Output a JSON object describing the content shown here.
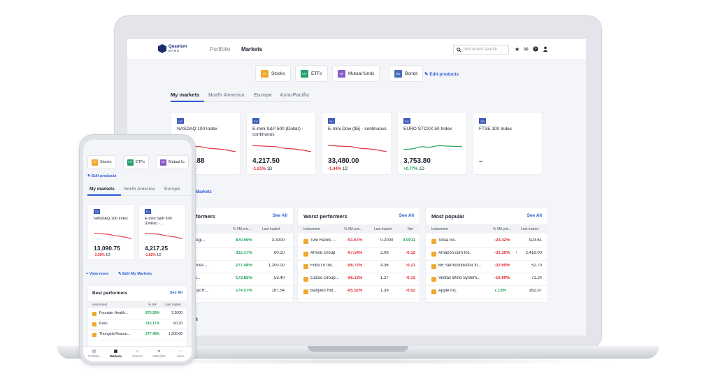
{
  "brand": {
    "name": "Quantum",
    "sub": "BANK"
  },
  "nav": {
    "portfolio": "Portfolio",
    "markets": "Markets"
  },
  "search": {
    "placeholder": "Instrument search"
  },
  "icons": {
    "search": "search-icon",
    "star": "star-icon",
    "mail": "mail-icon",
    "help": "help-icon",
    "user": "user-icon"
  },
  "categories": [
    {
      "label": "Stocks",
      "badge": "ST",
      "color": "#f0a830"
    },
    {
      "label": "ETFs",
      "badge": "ETF",
      "color": "#23a06a"
    },
    {
      "label": "Mutual funds",
      "badge": "MF",
      "color": "#8a5bc9"
    },
    {
      "label": "Bonds",
      "badge": "BD",
      "color": "#4a6fb8"
    }
  ],
  "edit_products": "Edit products",
  "tabs": [
    "My markets",
    "North America",
    "Europe",
    "Asia-Pacific"
  ],
  "indices": [
    {
      "flag": "US",
      "name": "NASDAQ 100 Index",
      "value": "13,090.75",
      "value_visible": "1.88",
      "change": "-3.28%",
      "period": "1D",
      "trend": "down"
    },
    {
      "flag": "FU",
      "name": "E-mini S&P 500 (Dollar) - continuous",
      "value": "4,217.50",
      "change": "-1.81%",
      "period": "1D",
      "trend": "down"
    },
    {
      "flag": "FU",
      "name": "E-mini Dow ($5) - continuous",
      "value": "33,480.00",
      "change": "-1.44%",
      "period": "1D",
      "trend": "down"
    },
    {
      "flag": "EU",
      "name": "EURO STOXX 50 Index",
      "value": "3,753.80",
      "change": "+0.77%",
      "period": "1D",
      "trend": "up"
    },
    {
      "flag": "GB",
      "name": "FTSE 100 Index",
      "value": "–",
      "change": "",
      "period": "",
      "trend": "none"
    }
  ],
  "manage_markets": "Markets",
  "best": {
    "title_visible": "rformers",
    "title": "Best performers",
    "see_all": "See All",
    "columns": [
      "% 6M pric...",
      "Last traded"
    ],
    "rows": [
      {
        "name": "n Healthy Agi...",
        "pct": "870.59%",
        "last": "3.3000"
      },
      {
        "name": "",
        "pct": "315.17%",
        "last": "60.20"
      },
      {
        "name": "ela Resources ...",
        "pct": "277.48%",
        "last": "1,200.00"
      },
      {
        "name": "novacion y...",
        "pct": "173.85%",
        "last": "53.40"
      },
      {
        "name": "Metallurgical R...",
        "pct": "174.57%",
        "last": "167.54"
      }
    ]
  },
  "worst": {
    "title": "Worst performers",
    "see_all": "See All",
    "columns": [
      "Instrument",
      "% 6M pric...",
      "Last traded",
      "Net"
    ],
    "rows": [
      {
        "name": "Two Hands ...",
        "pct": "-91.67%",
        "last": "0.2000",
        "net": "0.0011"
      },
      {
        "name": "Arrival Group",
        "pct": "-87.54%",
        "last": "2.08",
        "net": "-0.12"
      },
      {
        "name": "FuboTV Inc.",
        "pct": "-86.72%",
        "last": "4.36",
        "net": "-0.21"
      },
      {
        "name": "Cazoo Group...",
        "pct": "-86.12%",
        "last": "1.27",
        "net": "-0.13"
      },
      {
        "name": "Babylon Hol...",
        "pct": "-85.52%",
        "last": "1.39",
        "net": "-0.02"
      }
    ]
  },
  "popular": {
    "title": "Most popular",
    "see_all": "See All",
    "columns": [
      "Instrument",
      "% 6M pric...",
      "Last traded"
    ],
    "rows": [
      {
        "name": "Tesla Inc.",
        "pct": "-24.42%",
        "last": "923.61",
        "arrow": ""
      },
      {
        "name": "Amazon.com Inc.",
        "pct": "-31.29%",
        "last": "2,418.00",
        "arrow": "↑"
      },
      {
        "name": "BE Semiconductor In...",
        "pct": "-32.69%",
        "last": "52.70",
        "arrow": ""
      },
      {
        "name": "Vestas Wind System...",
        "pct": "-16.99%",
        "last": "71.24",
        "arrow": ""
      },
      {
        "name": "Apple Inc.",
        "pct": "7.13%",
        "last": "162.07",
        "arrow": ""
      }
    ]
  },
  "bottom_section_partial": "n",
  "mobile": {
    "categories": [
      {
        "label": "Stocks",
        "badge": "ST",
        "color": "#f0a830"
      },
      {
        "label": "ETFs",
        "badge": "ETF",
        "color": "#23a06a"
      },
      {
        "label": "Mutual fu",
        "badge": "MF",
        "color": "#8a5bc9"
      }
    ],
    "edit_products": "Edit products",
    "tabs": [
      "My markets",
      "North America",
      "Europe"
    ],
    "indices": [
      {
        "flag": "US",
        "name": "NASDAQ 100 Index",
        "value": "13,090.75",
        "change": "-3.28%",
        "period": "1D"
      },
      {
        "flag": "FU",
        "name": "E-mini S&P 500 (Dollar) - ...",
        "value": "4,217.25",
        "change": "-1.82%",
        "period": "1D"
      }
    ],
    "view_more": "View more",
    "edit_markets": "Edit My Markets",
    "best": {
      "title": "Best performers",
      "see_all": "See All",
      "columns": [
        "Instrument",
        "% 6M",
        "Last traded"
      ],
      "rows": [
        {
          "name": "Fountain Health...",
          "pct": "870.59%",
          "last": "3.3000"
        },
        {
          "name": "Esso",
          "pct": "315.17%",
          "last": "60.20"
        },
        {
          "name": "Thungela Resour...",
          "pct": "277.48%",
          "last": "1,200.00"
        }
      ]
    },
    "bottom_nav": [
      {
        "label": "Portfolio",
        "icon": "portfolio-icon",
        "glyph": "▤"
      },
      {
        "label": "Markets",
        "icon": "markets-icon",
        "glyph": "▣"
      },
      {
        "label": "Search",
        "icon": "search-icon",
        "glyph": "⌕"
      },
      {
        "label": "Watchlist",
        "icon": "star-icon",
        "glyph": "★"
      },
      {
        "label": "More",
        "icon": "more-icon",
        "glyph": "⋯"
      }
    ]
  },
  "colors": {
    "accent": "#2a5bd7",
    "negative": "#e0313b",
    "positive": "#1fa35a",
    "brand": "#1b2f6e"
  }
}
